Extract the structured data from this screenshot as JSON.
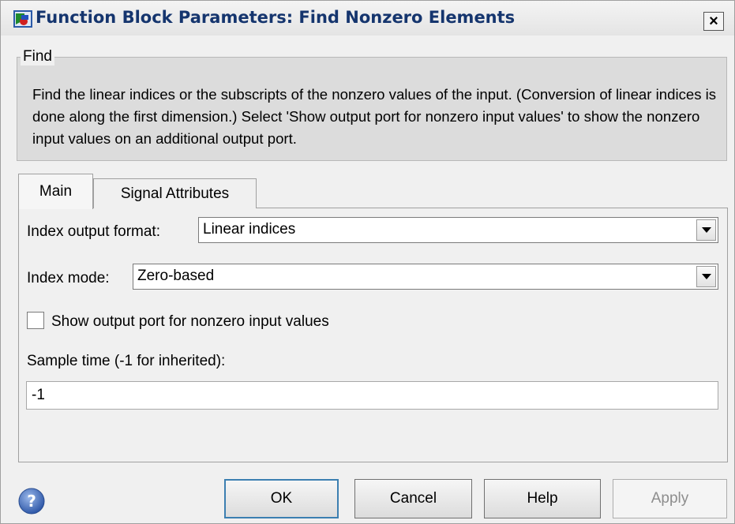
{
  "window": {
    "title": "Function Block Parameters: Find Nonzero Elements",
    "close_glyph": "×"
  },
  "find": {
    "legend": "Find",
    "description": "Find the linear indices or the subscripts of the nonzero values of the input. (Conversion of linear indices is done along the first dimension.) Select 'Show output port for nonzero input values' to show the nonzero input  values on an additional output port."
  },
  "tabs": [
    {
      "label": "Main",
      "selected": true
    },
    {
      "label": "Signal Attributes",
      "selected": false
    }
  ],
  "main": {
    "index_output_format": {
      "label": "Index output format:",
      "value": "Linear indices"
    },
    "index_mode": {
      "label": "Index mode:",
      "value": "Zero-based"
    },
    "show_output_port": {
      "label": "Show output port for nonzero input values",
      "checked": false
    },
    "sample_time": {
      "label": "Sample time (-1 for inherited):",
      "value": "-1"
    }
  },
  "buttons": {
    "ok": "OK",
    "cancel": "Cancel",
    "help": "Help",
    "apply": "Apply"
  },
  "icons": {
    "app": "simulink-block-icon",
    "help": "help-icon",
    "dropdown": "chevron-down-icon",
    "close": "close-icon"
  },
  "colors": {
    "title_text": "#15356e",
    "ok_focus_border": "#3c7fb1",
    "disabled_text": "#8d8d8d"
  }
}
